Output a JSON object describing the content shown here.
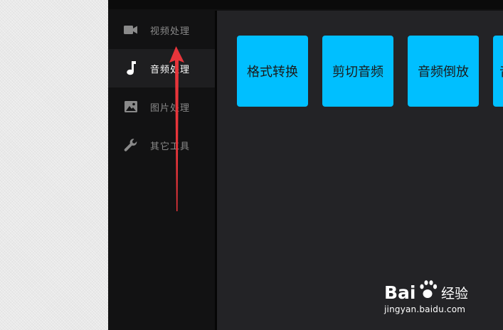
{
  "sidebar": {
    "items": [
      {
        "label": "视频处理",
        "icon": "video-camera-icon",
        "active": false
      },
      {
        "label": "音频处理",
        "icon": "music-note-icon",
        "active": true
      },
      {
        "label": "图片处理",
        "icon": "image-icon",
        "active": false
      },
      {
        "label": "其它工具",
        "icon": "wrench-icon",
        "active": false
      }
    ]
  },
  "content": {
    "tiles": [
      {
        "label": "格式转换"
      },
      {
        "label": "剪切音频"
      },
      {
        "label": "音频倒放"
      },
      {
        "label": "音"
      }
    ]
  },
  "colors": {
    "tile": "#00bfff",
    "arrow": "#e8353b",
    "active_item_bg": "#1e1e20",
    "content_bg": "#232326"
  },
  "watermark": {
    "brand": "Bai",
    "brand_suffix": "经验",
    "url": "jingyan.baidu.com"
  }
}
